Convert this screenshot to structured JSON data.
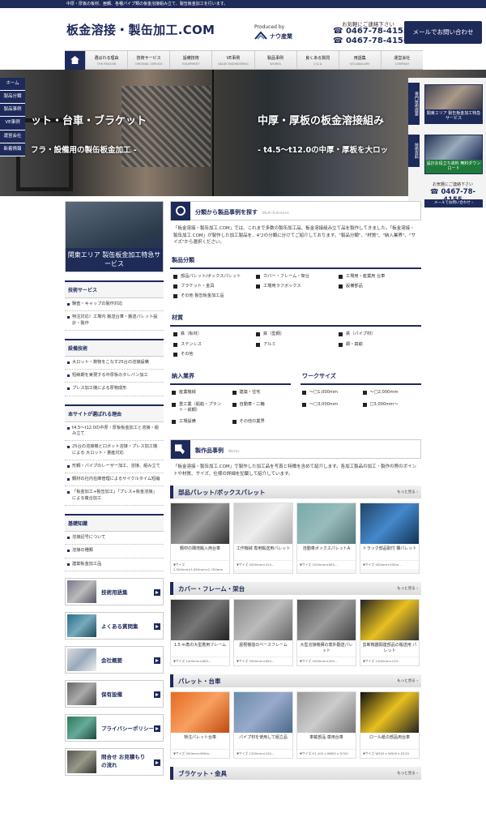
{
  "topstrip": "中厚・厚板の板材、亜鋼、各種パイプ類の板金溶接組み立て、製缶板金加工を行います。",
  "header": {
    "title": "板金溶接・製缶加工.COM",
    "produced_by": "Produced by",
    "maker": "ナウ産業",
    "contact_label": "お気軽にご連絡下さい",
    "phone1": "☎ 0467-78-4155",
    "phone2": "☎ 0467-78-4156",
    "mail_button": "メールでお問い合わせ"
  },
  "nav": [
    {
      "label": "選ばれる理由",
      "sub": "THE REASON"
    },
    {
      "label": "技術サービス",
      "sub": "ORIGINAL SERVICE"
    },
    {
      "label": "設備技術",
      "sub": "EQUIPMENT"
    },
    {
      "label": "VE事例",
      "sub": "VALUE ENGINEERING"
    },
    {
      "label": "製品事例",
      "sub": "WORKS"
    },
    {
      "label": "良くある質問",
      "sub": "Q & A"
    },
    {
      "label": "用語集",
      "sub": "VOCABULARY"
    },
    {
      "label": "運営会社",
      "sub": "COMPANY"
    }
  ],
  "hero": {
    "left_title": "ット・台車・ブラケット",
    "left_sub": "フラ・設備用の製缶板金加工 -",
    "right_title": "中厚・厚板の板金溶接組み",
    "right_sub": "- t4.5～t12.0の中厚・厚板を大ロッ"
  },
  "side_left": [
    "ホーム",
    "製品分類",
    "製品事例",
    "VE事例",
    "運営会社",
    "新着情報"
  ],
  "side_right": {
    "tab1": "専門技術提案",
    "card1": "関東エリア 製缶板金加工特急サービス",
    "tab2": "技術資料",
    "card2": "設計お役立ち資料 無料ダウンロード",
    "contact": "お気軽にご連絡下さい",
    "phone": "☎ 0467-78-4155",
    "mail": "メールでお問い合わせ ›"
  },
  "left": {
    "banner": "関東エリア 製缶板金加工特急サービス",
    "tech_h": "技術サービス",
    "tech": [
      "験査・キャップの製作対応",
      "特注対応！工場内 搬送台車・搬送パレット設計・製作"
    ],
    "eq_h": "設備技術",
    "eq": [
      "大ロット・数物をこなす25台の溶接設備",
      "短納期を実現する中厚板のタレパン加工",
      "プレス加工機による厚物成形"
    ],
    "reason_h": "本サイトが選ばれる理由",
    "reason": [
      "t4.5～t12.0の中厚・厚板板金加工と溶接・組み立て",
      "25台の溶接機と口ボット溶接・プレス加工機による 大ロット・量産対応",
      "形鋼・パイプのレーザー加工、溶接、組み立て",
      "鋼材の社内在庫管理によるサイクルタイム短縮",
      "「板金加工+製缶加工」「プレス+板金溶接」による複合加工"
    ],
    "basic_h": "基礎知識",
    "basic": [
      "溶接記号について",
      "溶接の種類",
      "建築板金加工品"
    ],
    "buttons": [
      "技術用語集",
      "よくある質問集",
      "会社概要",
      "保有設備",
      "プライバシーポリシー",
      "問合せ お見積もりの流れ"
    ]
  },
  "main": {
    "find_title": "分類から製品事例を探す",
    "find_en": "Multi Entrance",
    "intro": "「板金溶接・製缶加工.COM」では、これまで多数の製缶加工品、板金溶接組み立て品を製作してきました。「板金溶接・製缶加工.COM」が製作した加工製品を、4つの分類に分けてご紹介しております。\"製品分類\"、\"材質\"、\"納入業界\"、\"サイズ\"から選択ください。",
    "cat_h": "製品分類",
    "cats": [
      "部品パレット/ボックスパレット",
      "カバー・フレーム・架台",
      "工場用・産業用 台車",
      "ブラケット・金具",
      "工場用ラフボックス",
      "設備部品",
      "その他 製缶板金加工品"
    ],
    "mat_h": "材質",
    "mats": [
      "鉄（板材）",
      "鉄（型鋼）",
      "鉄（パイプ材）",
      "ステンレス",
      "アルミ",
      "銅・真鍮",
      "その他"
    ],
    "ind_h": "納入業界",
    "inds": [
      "産業機械",
      "建築・住宅",
      "重工業（船舶・プラント・鉄鋼）",
      "自動車・二輪",
      "工場設備",
      "その他の業界"
    ],
    "size_h": "ワークサイズ",
    "sizes": [
      "～□1,000mm",
      "～□2,000mm",
      "～□3,000mm",
      "□3,000mm～"
    ],
    "case_title": "製作品事例",
    "case_en": "Works",
    "case_intro": "「板金溶接・製缶加工.COM」で製作した加工品を写真と特徴を含めて紹介します。各加工製品の加工・製作の際のポイントや材質、サイズ、仕様の詳細を記載して紹介しています。",
    "more": "もっと見る ›",
    "sections": [
      {
        "title": "部品パレット/ボックスパレット",
        "items": [
          {
            "name": "鋼材の隅地搬入用台車",
            "size": "▼サイズ 2,500mm×1,620mm×2,700mm"
          },
          {
            "name": "工作機械 専用輸送用パレット",
            "size": "▼サイズ 4000mm×220..."
          },
          {
            "name": "自動車ボックスパレットA",
            "size": "▼サイズ 1500mm×800..."
          },
          {
            "name": "トラック部品取付 欄パレット",
            "size": "▼サイズ 900mm×500m..."
          }
        ]
      },
      {
        "title": "カバー・フレーム・架台",
        "items": [
          {
            "name": "1.5 m角の大型着用フレーム",
            "size": "▼サイズ 1400mm×600..."
          },
          {
            "name": "屋根機能のベースフレーム",
            "size": "▼サイズ 3500mm×600..."
          },
          {
            "name": "大型溶接機構の専外翻送パレット",
            "size": "▼サイズ 2000mm×200..."
          },
          {
            "name": "剪断機器関連部品の搬送用 パレット",
            "size": "▼サイズ 1200mm×120..."
          }
        ]
      },
      {
        "title": "パレット・台車",
        "items": [
          {
            "name": "特注パレット台車",
            "size": "▼サイズ 900mm×600m..."
          },
          {
            "name": "パイプ材を使用して組立品",
            "size": "▼サイズ 1200mm×100..."
          },
          {
            "name": "車載部品 専用台車",
            "size": "▼サイズ H1,100 x W800 x D700"
          },
          {
            "name": "ロール紙の部品用台車",
            "size": "▼サイズ W500 x W900 x D120"
          }
        ]
      },
      {
        "title": "ブラケット・金具",
        "items": []
      }
    ]
  },
  "colors": {
    "accent": "#1d2a5a"
  }
}
